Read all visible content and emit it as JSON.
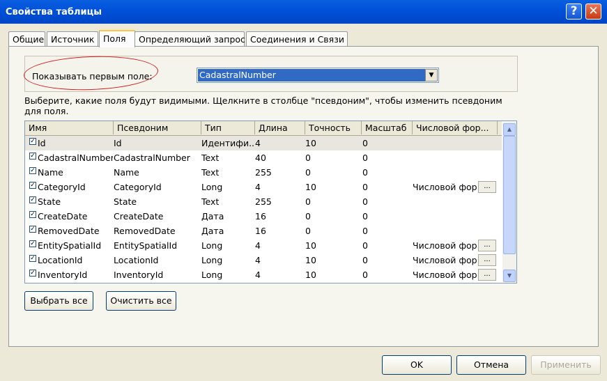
{
  "window": {
    "title": "Свойства таблицы",
    "help_label": "?",
    "close_label": "✕"
  },
  "tabs": [
    {
      "label": "Общие"
    },
    {
      "label": "Источник"
    },
    {
      "label": "Поля",
      "active": true
    },
    {
      "label": "Определяющий запрос"
    },
    {
      "label": "Соединения и Связи"
    }
  ],
  "first_field": {
    "label": "Показывать первым поле:",
    "value": "CadastralNumber",
    "arrow": "▼"
  },
  "description": "Выберите, какие поля будут видимыми. Щелкните в столбце \"псевдоним\", чтобы изменить псевдоним для поля.",
  "columns": [
    "Имя",
    "Псевдоним",
    "Тип",
    "Длина",
    "Точность",
    "Масштаб",
    "Числовой фор..."
  ],
  "rows": [
    {
      "name": "Id",
      "alias": "Id",
      "type": "Идентифи...",
      "length": "4",
      "precision": "10",
      "scale": "0",
      "numfmt": "",
      "checked": true
    },
    {
      "name": "CadastralNumber",
      "alias": "CadastralNumber",
      "type": "Text",
      "length": "40",
      "precision": "0",
      "scale": "0",
      "numfmt": "",
      "checked": true
    },
    {
      "name": "Name",
      "alias": "Name",
      "type": "Text",
      "length": "255",
      "precision": "0",
      "scale": "0",
      "numfmt": "",
      "checked": true
    },
    {
      "name": "CategoryId",
      "alias": "CategoryId",
      "type": "Long",
      "length": "4",
      "precision": "10",
      "scale": "0",
      "numfmt": "Числовой фор",
      "checked": true
    },
    {
      "name": "State",
      "alias": "State",
      "type": "Text",
      "length": "255",
      "precision": "0",
      "scale": "0",
      "numfmt": "",
      "checked": true
    },
    {
      "name": "CreateDate",
      "alias": "CreateDate",
      "type": "Дата",
      "length": "16",
      "precision": "0",
      "scale": "0",
      "numfmt": "",
      "checked": true
    },
    {
      "name": "RemovedDate",
      "alias": "RemovedDate",
      "type": "Дата",
      "length": "16",
      "precision": "0",
      "scale": "0",
      "numfmt": "",
      "checked": true
    },
    {
      "name": "EntitySpatialId",
      "alias": "EntitySpatialId",
      "type": "Long",
      "length": "4",
      "precision": "10",
      "scale": "0",
      "numfmt": "Числовой фор",
      "checked": true
    },
    {
      "name": "LocationId",
      "alias": "LocationId",
      "type": "Long",
      "length": "4",
      "precision": "10",
      "scale": "0",
      "numfmt": "Числовой фор",
      "checked": true
    },
    {
      "name": "InventoryId",
      "alias": "InventoryId",
      "type": "Long",
      "length": "4",
      "precision": "10",
      "scale": "0",
      "numfmt": "Числовой фор",
      "checked": true
    }
  ],
  "ellipsis_label": "...",
  "scroll": {
    "up": "▲",
    "down": "▼"
  },
  "buttons": {
    "select_all": "Выбрать все",
    "clear_all": "Очистить все",
    "ok": "OK",
    "cancel": "Отмена",
    "apply": "Применить"
  }
}
